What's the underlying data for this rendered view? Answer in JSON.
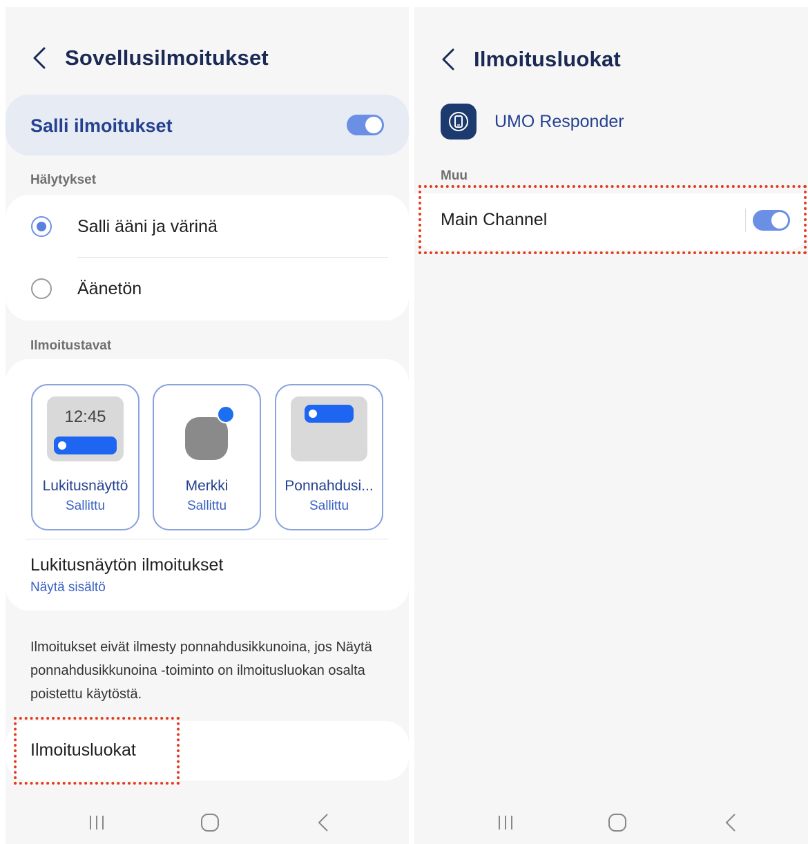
{
  "left": {
    "header": {
      "title": "Sovellusilmoitukset"
    },
    "allow": {
      "label": "Salli ilmoitukset",
      "enabled": true
    },
    "alerts": {
      "section": "Hälytykset",
      "options": [
        {
          "label": "Salli ääni ja värinä",
          "selected": true
        },
        {
          "label": "Äänetön",
          "selected": false
        }
      ]
    },
    "methods": {
      "section": "Ilmoitustavat",
      "items": [
        {
          "name": "Lukitusnäyttö",
          "state": "Sallittu",
          "preview_time": "12:45"
        },
        {
          "name": "Merkki",
          "state": "Sallittu"
        },
        {
          "name": "Ponnahdusi...",
          "state": "Sallittu"
        }
      ],
      "lock_title": "Lukitusnäytön ilmoitukset",
      "lock_sub": "Näytä sisältö"
    },
    "info": "Ilmoitukset eivät ilmesty ponnahdusikkunoina, jos Näytä ponnahdusikkunoina -toiminto on ilmoitusluokan osalta poistettu käytöstä.",
    "categories": {
      "label": "Ilmoitusluokat"
    }
  },
  "right": {
    "header": {
      "title": "Ilmoitusluokat"
    },
    "app": {
      "name": "UMO Responder",
      "icon": "phone-icon"
    },
    "section": "Muu",
    "channel": {
      "label": "Main Channel",
      "enabled": true
    }
  },
  "colors": {
    "accent": "#6c8fe6",
    "title": "#1b2a55",
    "link": "#3a62c2",
    "highlight": "#e33b1e",
    "notif_bar": "#1e66f2"
  }
}
